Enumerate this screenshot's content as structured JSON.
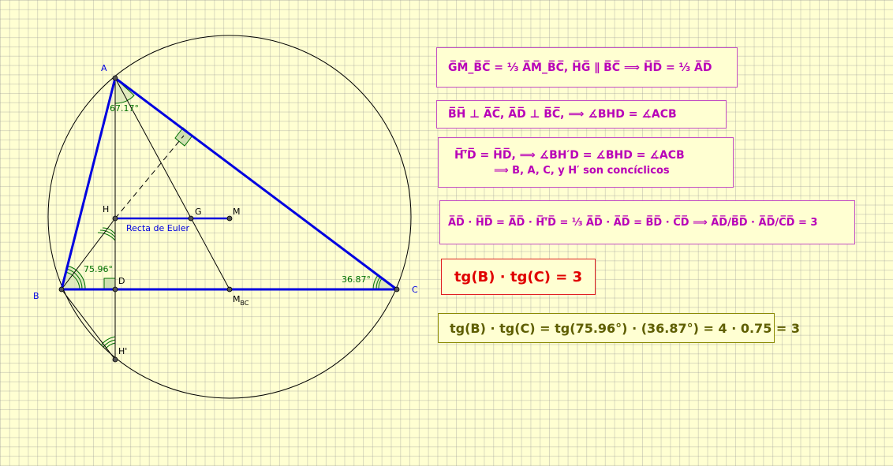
{
  "points": {
    "A": "A",
    "B": "B",
    "C": "C",
    "D": "D",
    "H": "H",
    "G": "G",
    "M": "M",
    "M_main": "M",
    "M_sub": "BC",
    "Hp": "H'"
  },
  "angles": {
    "A": "67.17°",
    "B": "75.96°",
    "C": "36.87°"
  },
  "euler_label": "Recta de Euler",
  "formulas": {
    "f1": "G̅M̅_B̅C̅  =  ⅓ A̅M̅_B̅C̅,  H̅G̅ ∥ B̅C̅  ⟹  H̅D̅  =  ⅓ A̅D̅",
    "f2": "B̅H̅  ⊥  A̅C̅,  A̅D̅  ⊥  B̅C̅,  ⟹  ∡BHD  =  ∡ACB",
    "f3a": "H̅'̅D̅  =  H̅D̅,  ⟹  ∡BH′D  = ∡BHD  =  ∡ACB",
    "f3b": "⟹  B,  A,  C,  y H′ son concíclicos",
    "f4": "A̅D̅ · H̅D̅  =  A̅D̅ · H̅'̅D̅  =  ⅓ A̅D̅ · A̅D̅  =  B̅D̅ · C̅D̅  ⟹  A̅D̅/B̅D̅ · A̅D̅/C̅D̅  =  3",
    "f5": "tg(B) · tg(C)  =  3",
    "f6": "tg(B) · tg(C) = tg(75.96°) · (36.87°) = 4 · 0.75 = 3"
  },
  "colors": {
    "background": "#ffffd2",
    "triangle": "#0000e0",
    "point_label": "#0000e0",
    "angle": "#007000",
    "formula": "#b800b8",
    "highlight": "#e00000",
    "result": "#5e5e00"
  }
}
